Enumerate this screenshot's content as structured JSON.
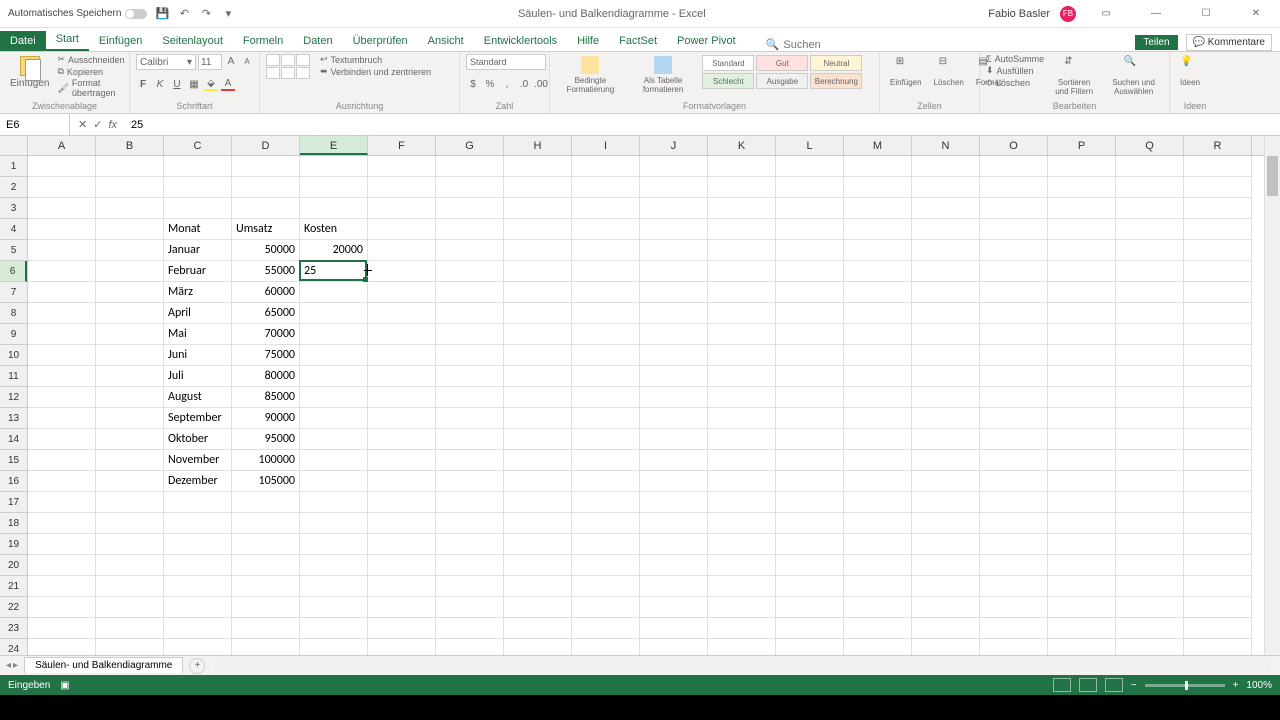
{
  "titlebar": {
    "autosave": "Automatisches Speichern",
    "doc_title": "Säulen- und Balkendiagramme  -  Excel",
    "user": "Fabio Basler",
    "user_initials": "FB"
  },
  "tabs": {
    "file": "Datei",
    "start": "Start",
    "insert": "Einfügen",
    "pagelayout": "Seitenlayout",
    "formulas": "Formeln",
    "data": "Daten",
    "review": "Überprüfen",
    "view": "Ansicht",
    "developer": "Entwicklertools",
    "help": "Hilfe",
    "factset": "FactSet",
    "powerpivot": "Power Pivot",
    "search_placeholder": "Suchen",
    "share": "Teilen",
    "comments": "Kommentare"
  },
  "ribbon": {
    "clipboard": {
      "paste": "Einfügen",
      "cut": "Ausschneiden",
      "copy": "Kopieren",
      "format": "Format übertragen",
      "label": "Zwischenablage"
    },
    "font": {
      "name": "Calibri",
      "size": "11",
      "label": "Schriftart"
    },
    "align": {
      "wrap": "Textumbruch",
      "merge": "Verbinden und zentrieren",
      "label": "Ausrichtung"
    },
    "number": {
      "format": "Standard",
      "label": "Zahl"
    },
    "styles": {
      "cond": "Bedingte Formatierung",
      "table": "Als Tabelle formatieren",
      "s1": "Standard",
      "s2": "Gut",
      "s3": "Neutral",
      "s4": "Schlecht",
      "s5": "Ausgabe",
      "s6": "Berechnung",
      "label": "Formatvorlagen"
    },
    "cells": {
      "insert": "Einfügen",
      "delete": "Löschen",
      "format": "Format",
      "label": "Zellen"
    },
    "editing": {
      "sum": "AutoSumme",
      "fill": "Ausfüllen",
      "clear": "Löschen",
      "sort": "Sortieren und Filtern",
      "find": "Suchen und Auswählen",
      "label": "Bearbeiten"
    },
    "ideas": {
      "btn": "Ideen",
      "label": "Ideen"
    }
  },
  "formula": {
    "cell_ref": "E6",
    "value": "25"
  },
  "columns": [
    "A",
    "B",
    "C",
    "D",
    "E",
    "F",
    "G",
    "H",
    "I",
    "J",
    "K",
    "L",
    "M",
    "N",
    "O",
    "P",
    "Q",
    "R"
  ],
  "active_col_idx": 4,
  "active_row_idx": 5,
  "sheet": {
    "C4": "Monat",
    "D4": "Umsatz",
    "E4": "Kosten",
    "C5": "Januar",
    "D5": "50000",
    "E5": "20000",
    "C6": "Februar",
    "D6": "55000",
    "E6": "25",
    "C7": "März",
    "D7": "60000",
    "C8": "April",
    "D8": "65000",
    "C9": "Mai",
    "D9": "70000",
    "C10": "Juni",
    "D10": "75000",
    "C11": "Juli",
    "D11": "80000",
    "C12": "August",
    "D12": "85000",
    "C13": "September",
    "D13": "90000",
    "C14": "Oktober",
    "D14": "95000",
    "C15": "November",
    "D15": "100000",
    "C16": "Dezember",
    "D16": "105000"
  },
  "sheet_tab": "Säulen- und Balkendiagramme",
  "status": {
    "mode": "Eingeben",
    "zoom": "100%"
  },
  "chart_data": {
    "type": "table",
    "title": "Monat / Umsatz / Kosten",
    "columns": [
      "Monat",
      "Umsatz",
      "Kosten"
    ],
    "rows": [
      [
        "Januar",
        50000,
        20000
      ],
      [
        "Februar",
        55000,
        null
      ],
      [
        "März",
        60000,
        null
      ],
      [
        "April",
        65000,
        null
      ],
      [
        "Mai",
        70000,
        null
      ],
      [
        "Juni",
        75000,
        null
      ],
      [
        "Juli",
        80000,
        null
      ],
      [
        "August",
        85000,
        null
      ],
      [
        "September",
        90000,
        null
      ],
      [
        "Oktober",
        95000,
        null
      ],
      [
        "November",
        100000,
        null
      ],
      [
        "Dezember",
        105000,
        null
      ]
    ]
  }
}
